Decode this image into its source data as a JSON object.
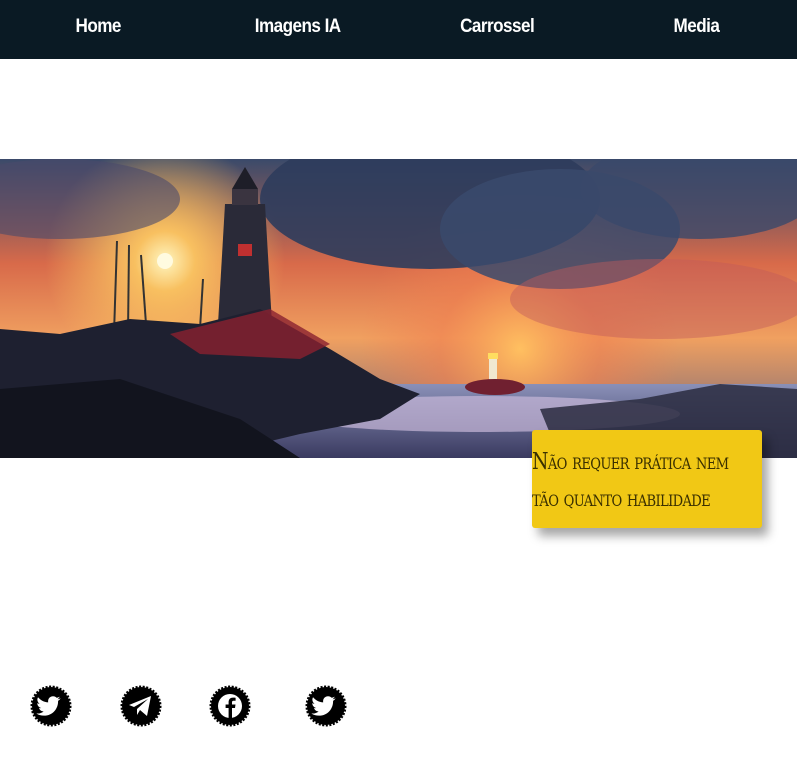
{
  "nav": {
    "items": [
      {
        "label": "Home"
      },
      {
        "label": "Imagens IA"
      },
      {
        "label": "Carrossel"
      },
      {
        "label": "Media"
      }
    ]
  },
  "card": {
    "line1": "Não requer prática nem",
    "line2": "tão quanto habilidade"
  },
  "social": {
    "icons": [
      "twitter-icon",
      "telegram-icon",
      "facebook-icon",
      "twitter-icon"
    ]
  },
  "colors": {
    "nav_background": "#0a1a24",
    "card_background": "#f1c815",
    "nav_text": "#ffffff"
  }
}
